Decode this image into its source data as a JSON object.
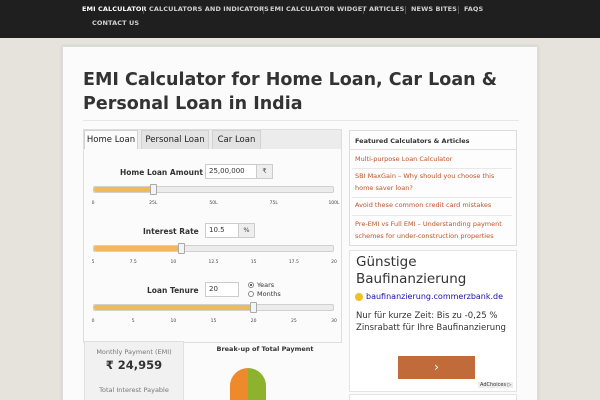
{
  "nav": {
    "items": [
      {
        "label": "EMI CALCULATOR",
        "active": true
      },
      {
        "label": "CALCULATORS AND INDICATORS"
      },
      {
        "label": "EMI CALCULATOR WIDGET"
      },
      {
        "label": "ARTICLES"
      },
      {
        "label": "NEWS BITES"
      },
      {
        "label": "FAQS"
      },
      {
        "label": "CONTACT US"
      }
    ]
  },
  "page": {
    "title_line1": "EMI Calculator for Home Loan, Car Loan &",
    "title_line2": "Personal Loan in India"
  },
  "calculator": {
    "tabs": [
      "Home Loan",
      "Personal Loan",
      "Car Loan"
    ],
    "active_tab": "Home Loan",
    "amount": {
      "label": "Home Loan Amount",
      "value": "25,00,000",
      "unit": "₹",
      "ticks": [
        "0",
        "25L",
        "50L",
        "75L",
        "100L"
      ],
      "fraction": 0.25
    },
    "rate": {
      "label": "Interest Rate",
      "value": "10.5",
      "unit": "%",
      "ticks": [
        "5",
        "7.5",
        "10",
        "12.5",
        "15",
        "17.5",
        "20"
      ],
      "fraction": 0.3667
    },
    "tenure": {
      "label": "Loan Tenure",
      "value": "20",
      "options": [
        "Years",
        "Months"
      ],
      "selected": "Years",
      "ticks": [
        "0",
        "5",
        "10",
        "15",
        "20",
        "25",
        "30"
      ],
      "fraction": 0.6667
    },
    "results": {
      "emi_label": "Monthly Payment (EMI)",
      "emi_value": "₹ 24,959",
      "interest_label": "Total Interest Payable"
    },
    "breakup_title": "Break-up of Total Payment",
    "colors": {
      "slider_fill": "#f0b95a",
      "pie_interest": "#ef8a2c",
      "pie_principal": "#8db32e"
    }
  },
  "featured": {
    "title": "Featured Calculators & Articles",
    "links": [
      "Multi-purpose Loan Calculator",
      "SBI MaxGain – Why should you choose this home saver loan?",
      "Avoid these common credit card mistakes",
      "Pre-EMI vs Full EMI – Understanding payment schemes for under-construction properties"
    ],
    "link_color": "#c0532c"
  },
  "ad": {
    "title_line1": "Günstige",
    "title_line2": "Baufinanzierung",
    "url": "baufinanzierung.commerzbank.de",
    "body": "Nur für kurze Zeit: Bis zu -0,25 % Zinsrabatt für Ihre Baufinanzierung",
    "cta": "›",
    "adchoices": "AdChoices ▷"
  }
}
